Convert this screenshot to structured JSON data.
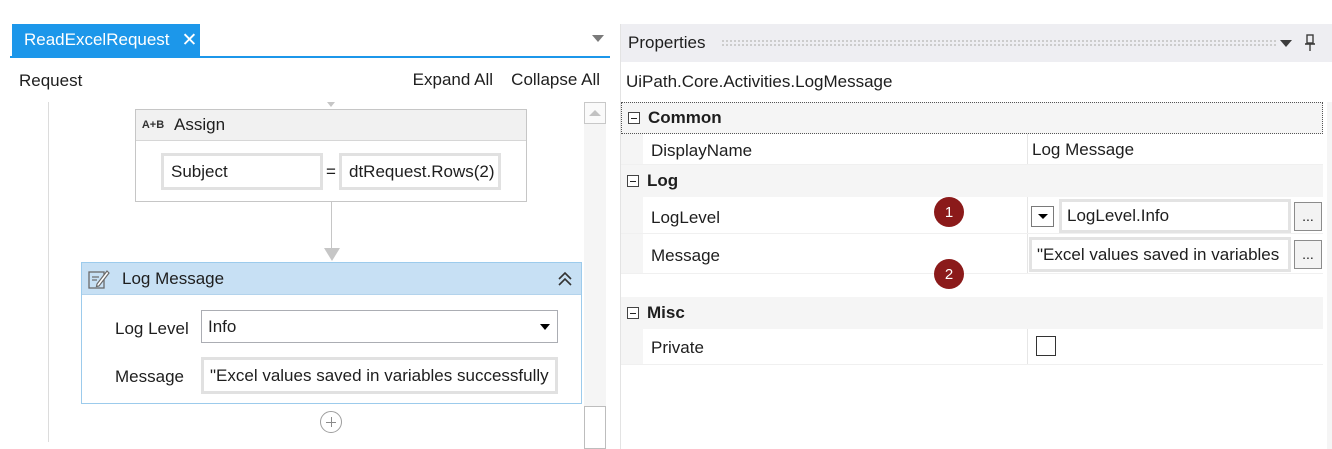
{
  "designer": {
    "tab_label": "ReadExcelRequest",
    "tab_close_glyph": "✕",
    "breadcrumb": "Request",
    "expand_all": "Expand All",
    "collapse_all": "Collapse All"
  },
  "assign": {
    "icon_text": "A+B",
    "title": "Assign",
    "to": "Subject",
    "equals": "=",
    "value": "dtRequest.Rows(2)"
  },
  "log_message": {
    "title": "Log Message",
    "log_level_label": "Log Level",
    "log_level_value": "Info",
    "message_label": "Message",
    "message_value": "\"Excel values saved in variables successfully"
  },
  "properties": {
    "title": "Properties",
    "type_name": "UiPath.Core.Activities.LogMessage",
    "categories": {
      "common": "Common",
      "log": "Log",
      "misc": "Misc"
    },
    "rows": {
      "display_name": {
        "name": "DisplayName",
        "value": "Log Message"
      },
      "log_level": {
        "name": "LogLevel",
        "value": "LogLevel.Info"
      },
      "message": {
        "name": "Message",
        "value": "\"Excel values saved in variables"
      },
      "private": {
        "name": "Private",
        "checked": false
      }
    },
    "ellipsis": "...",
    "badges": [
      "1",
      "2"
    ]
  },
  "colors": {
    "accent": "#1c97ea",
    "activity_header_selected": "#c7e0f4",
    "badge": "#8b1a1a"
  }
}
